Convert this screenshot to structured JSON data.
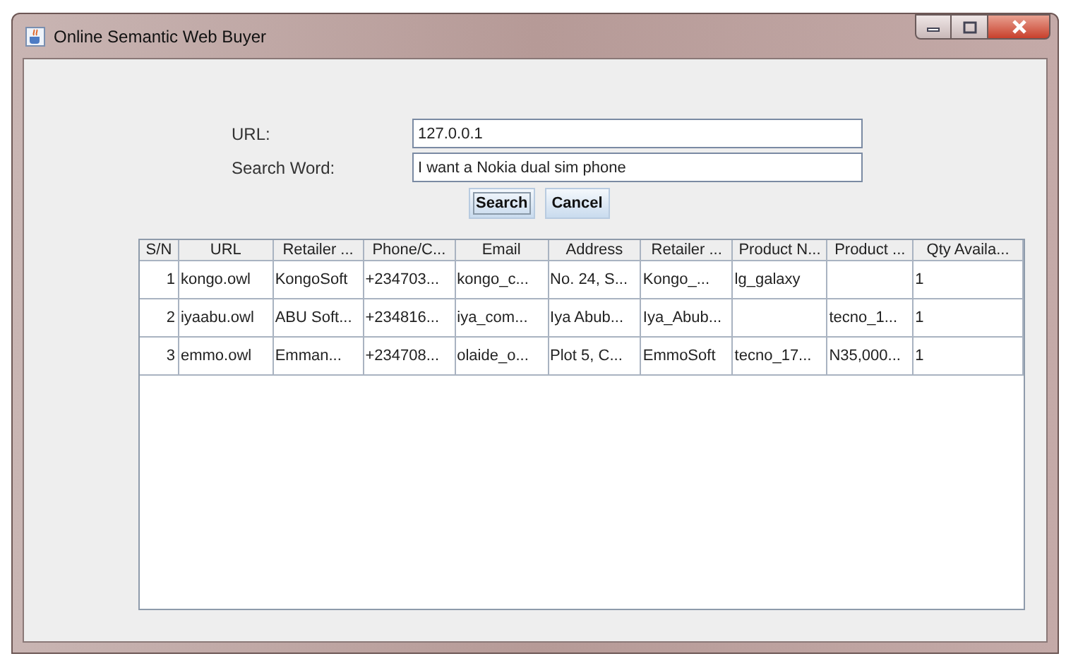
{
  "window": {
    "title": "Online Semantic Web Buyer"
  },
  "form": {
    "fields": [
      {
        "label": "URL:",
        "value": "127.0.0.1"
      },
      {
        "label": "Search Word:",
        "value": "I want a Nokia dual sim phone"
      }
    ],
    "buttons": [
      {
        "label": "Search",
        "selected": true
      },
      {
        "label": "Cancel",
        "selected": false
      }
    ]
  },
  "table": {
    "columns": [
      "S/N",
      "URL",
      "Retailer ...",
      "Phone/C...",
      "Email",
      "Address",
      "Retailer ...",
      "Product N...",
      "Product ...",
      "Qty Availa..."
    ],
    "rows": [
      [
        "1",
        "kongo.owl",
        "KongoSoft",
        "+234703...",
        "kongo_c...",
        "No. 24, S...",
        "Kongo_...",
        "lg_galaxy",
        "",
        "1"
      ],
      [
        "2",
        "iyaabu.owl",
        "ABU Soft...",
        "+234816...",
        "iya_com...",
        "Iya Abub...",
        "Iya_Abub...",
        "",
        "tecno_1...",
        "1"
      ],
      [
        "3",
        "emmo.owl",
        "Emman...",
        "+234708...",
        "olaide_o...",
        "Plot 5, C...",
        "EmmoSoft",
        "tecno_17...",
        "N35,000...",
        "1"
      ]
    ]
  }
}
